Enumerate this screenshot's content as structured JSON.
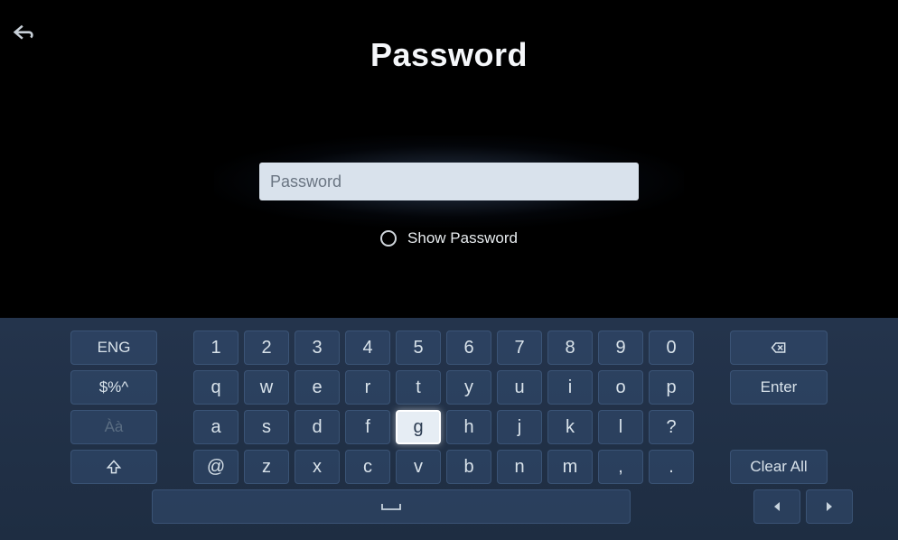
{
  "title": "Password",
  "input": {
    "placeholder": "Password",
    "value": ""
  },
  "show_password_label": "Show Password",
  "show_password_checked": false,
  "keyboard": {
    "side_keys": [
      "ENG",
      "$%^",
      "Àà",
      "shift"
    ],
    "rows": [
      [
        "1",
        "2",
        "3",
        "4",
        "5",
        "6",
        "7",
        "8",
        "9",
        "0"
      ],
      [
        "q",
        "w",
        "e",
        "r",
        "t",
        "y",
        "u",
        "i",
        "o",
        "p"
      ],
      [
        "a",
        "s",
        "d",
        "f",
        "g",
        "h",
        "j",
        "k",
        "l",
        "?"
      ],
      [
        "@",
        "z",
        "x",
        "c",
        "v",
        "b",
        "n",
        "m",
        ",",
        "."
      ]
    ],
    "action_keys": [
      "backspace",
      "Enter",
      "",
      "Clear All"
    ],
    "highlighted_key": "g",
    "disabled_side_key": "Àà"
  }
}
